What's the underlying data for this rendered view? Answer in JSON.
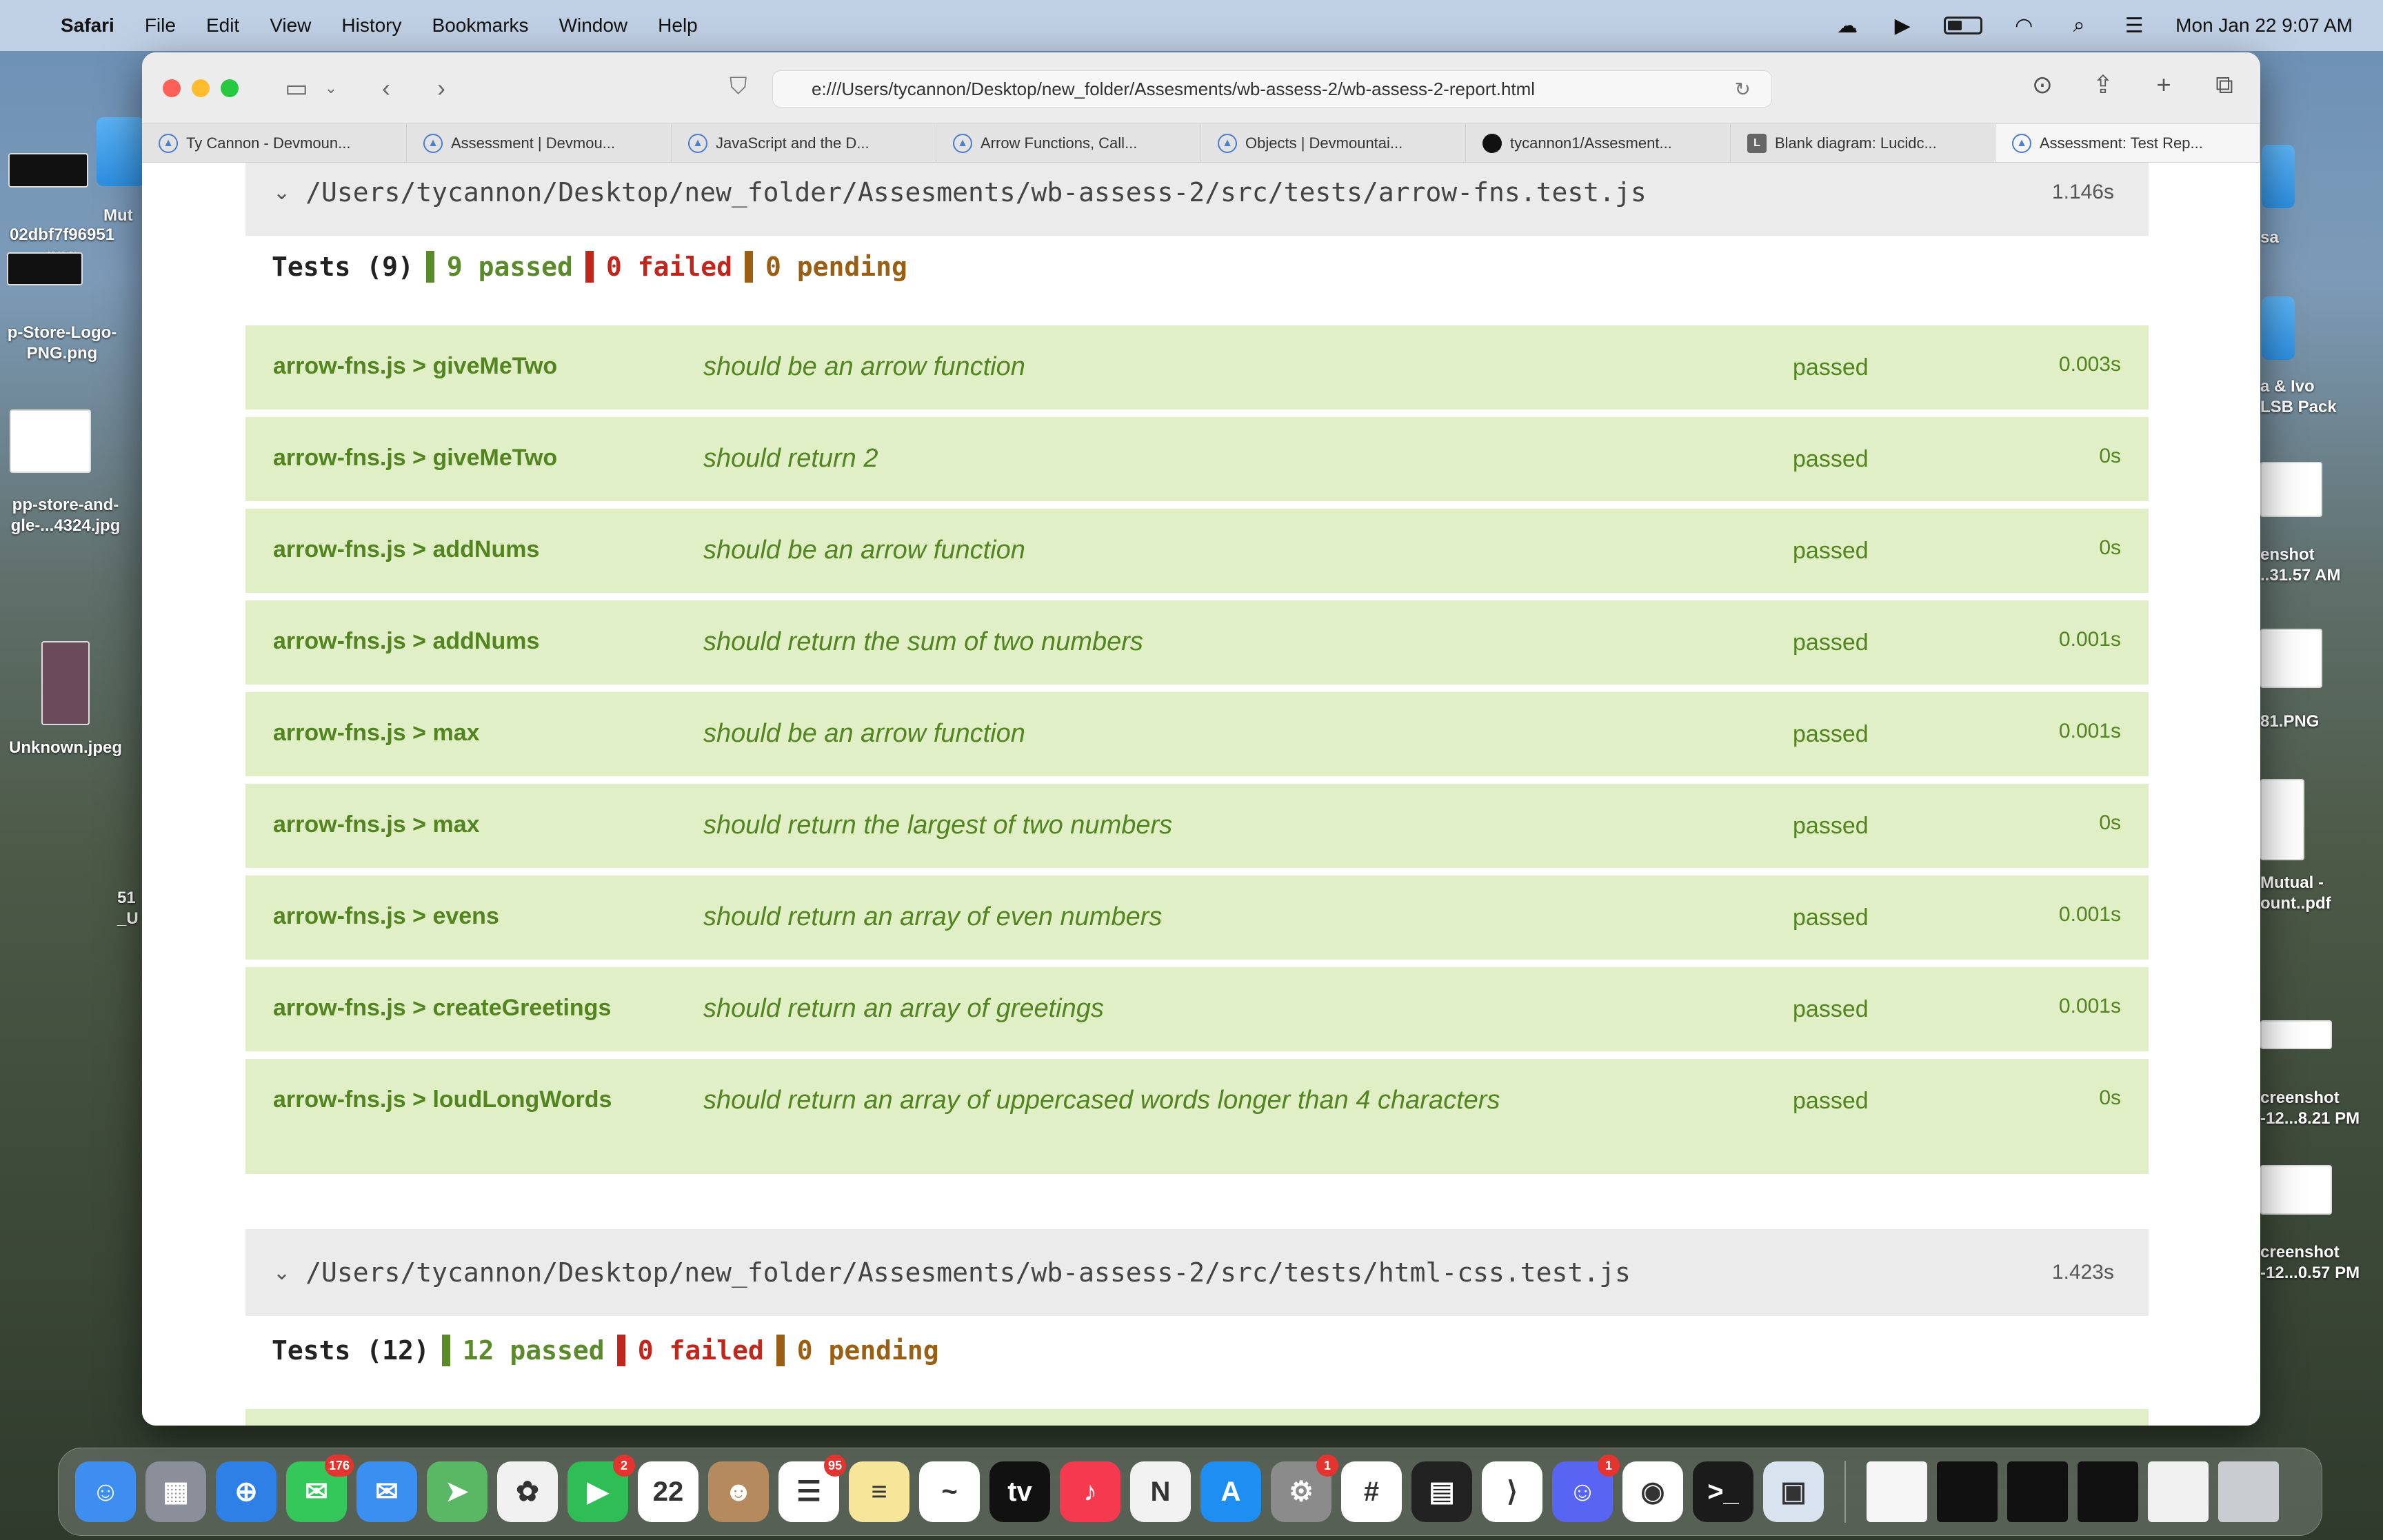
{
  "menubar": {
    "app_name": "Safari",
    "menus": [
      "File",
      "Edit",
      "View",
      "History",
      "Bookmarks",
      "Window",
      "Help"
    ],
    "clock": "Mon Jan 22  9:07 AM"
  },
  "desktop": {
    "left_labels": [
      "02dbf7f96951\npng",
      "p-Store-Logo-\nPNG.png",
      "pp-store-and-\ngle-...4324.jpg",
      "Unknown.jpeg",
      "51\n_U"
    ],
    "left_partial_top": "Mut",
    "right_labels": [
      "sa",
      "a & Ivo\nLSB Pack",
      "enshot\n..31.57 AM",
      "81.PNG",
      "Mutual -\nount..pdf",
      "creenshot\n-12...8.21 PM",
      "creenshot\n-12...0.57 PM"
    ]
  },
  "browser": {
    "url": "e:///Users/tycannon/Desktop/new_folder/Assesments/wb-assess-2/wb-assess-2-report.html",
    "tabs": [
      {
        "title": "Ty Cannon - Devmoun...",
        "icon": "devmountain-icon"
      },
      {
        "title": "Assessment | Devmou...",
        "icon": "devmountain-icon"
      },
      {
        "title": "JavaScript and the D...",
        "icon": "devmountain-icon"
      },
      {
        "title": "Arrow Functions, Call...",
        "icon": "devmountain-icon"
      },
      {
        "title": "Objects | Devmountai...",
        "icon": "devmountain-icon"
      },
      {
        "title": "tycannon1/Assesment...",
        "icon": "github-icon"
      },
      {
        "title": "Blank diagram: Lucidc...",
        "icon": "lucidchart-icon"
      },
      {
        "title": "Assessment: Test Rep...",
        "icon": "devmountain-icon"
      }
    ]
  },
  "report": {
    "suite1": {
      "path": "/Users/tycannon/Desktop/new_folder/Assesments/wb-assess-2/src/tests/arrow-fns.test.js",
      "time": "1.146s",
      "tests_label": "Tests (9)",
      "passed": "9 passed",
      "failed": "0 failed",
      "pending": "0 pending",
      "rows": [
        {
          "name": "arrow-fns.js > giveMeTwo",
          "desc": "should be an arrow function",
          "status": "passed",
          "dur": "0.003s"
        },
        {
          "name": "arrow-fns.js > giveMeTwo",
          "desc": "should return 2",
          "status": "passed",
          "dur": "0s"
        },
        {
          "name": "arrow-fns.js > addNums",
          "desc": "should be an arrow function",
          "status": "passed",
          "dur": "0s"
        },
        {
          "name": "arrow-fns.js > addNums",
          "desc": "should return the sum of two numbers",
          "status": "passed",
          "dur": "0.001s"
        },
        {
          "name": "arrow-fns.js > max",
          "desc": "should be an arrow function",
          "status": "passed",
          "dur": "0.001s"
        },
        {
          "name": "arrow-fns.js > max",
          "desc": "should return the largest of two numbers",
          "status": "passed",
          "dur": "0s"
        },
        {
          "name": "arrow-fns.js > evens",
          "desc": "should return an array of even numbers",
          "status": "passed",
          "dur": "0.001s"
        },
        {
          "name": "arrow-fns.js > createGreetings",
          "desc": "should return an array of greetings",
          "status": "passed",
          "dur": "0.001s"
        },
        {
          "name": "arrow-fns.js > loudLongWords",
          "desc": "should return an array of uppercased words longer than 4 characters",
          "status": "passed",
          "dur": "0s"
        }
      ]
    },
    "suite2": {
      "path": "/Users/tycannon/Desktop/new_folder/Assesments/wb-assess-2/src/tests/html-css.test.js",
      "time": "1.423s",
      "tests_label": "Tests (12)",
      "passed": "12 passed",
      "failed": "0 failed",
      "pending": "0 pending"
    }
  },
  "dock": {
    "apps": [
      {
        "name": "finder",
        "color": "#3d8ef0",
        "glyph": "☺"
      },
      {
        "name": "launchpad",
        "color": "#8a8f99",
        "glyph": "▦"
      },
      {
        "name": "safari",
        "color": "#2e7fe6",
        "glyph": "⊕"
      },
      {
        "name": "messages",
        "color": "#34c759",
        "glyph": "✉",
        "badge": "176"
      },
      {
        "name": "mail",
        "color": "#3a8ff0",
        "glyph": "✉"
      },
      {
        "name": "maps",
        "color": "#5ab865",
        "glyph": "➤"
      },
      {
        "name": "photos",
        "color": "#f1f1f1",
        "glyph": "✿"
      },
      {
        "name": "facetime",
        "color": "#2fbd55",
        "glyph": "▶",
        "badge": "2"
      },
      {
        "name": "calendar",
        "color": "#ffffff",
        "glyph": "22"
      },
      {
        "name": "contacts",
        "color": "#b48a5e",
        "glyph": "☻"
      },
      {
        "name": "reminders",
        "color": "#ffffff",
        "glyph": "☰",
        "badge": "95"
      },
      {
        "name": "notes",
        "color": "#f7e59a",
        "glyph": "≡"
      },
      {
        "name": "freeform",
        "color": "#ffffff",
        "glyph": "~"
      },
      {
        "name": "apple-tv",
        "color": "#111111",
        "glyph": "tv"
      },
      {
        "name": "music",
        "color": "#f53a4f",
        "glyph": "♪"
      },
      {
        "name": "news",
        "color": "#f2f2f2",
        "glyph": "N"
      },
      {
        "name": "app-store",
        "color": "#1e8ef2",
        "glyph": "A"
      },
      {
        "name": "system-settings",
        "color": "#8b8b8b",
        "glyph": "⚙",
        "badge": "1"
      },
      {
        "name": "slack",
        "color": "#ffffff",
        "glyph": "#"
      },
      {
        "name": "final-cut",
        "color": "#222222",
        "glyph": "▤"
      },
      {
        "name": "vscode",
        "color": "#ffffff",
        "glyph": "⟩"
      },
      {
        "name": "discord",
        "color": "#5865f2",
        "glyph": "☺",
        "badge": "1"
      },
      {
        "name": "chrome",
        "color": "#ffffff",
        "glyph": "◉"
      },
      {
        "name": "terminal",
        "color": "#1b1b1b",
        "glyph": ">_"
      },
      {
        "name": "preview",
        "color": "#d9e3ef",
        "glyph": "▣"
      }
    ],
    "recents": [
      {
        "name": "recent-doc",
        "color": "#f5f5f5"
      },
      {
        "name": "recent-terminal-1",
        "color": "#111111"
      },
      {
        "name": "recent-terminal-2",
        "color": "#111111"
      },
      {
        "name": "recent-terminal-3",
        "color": "#111111"
      },
      {
        "name": "recent-chrome-window",
        "color": "#f0f0f0"
      },
      {
        "name": "trash",
        "color": "#c9ccd1"
      }
    ]
  }
}
